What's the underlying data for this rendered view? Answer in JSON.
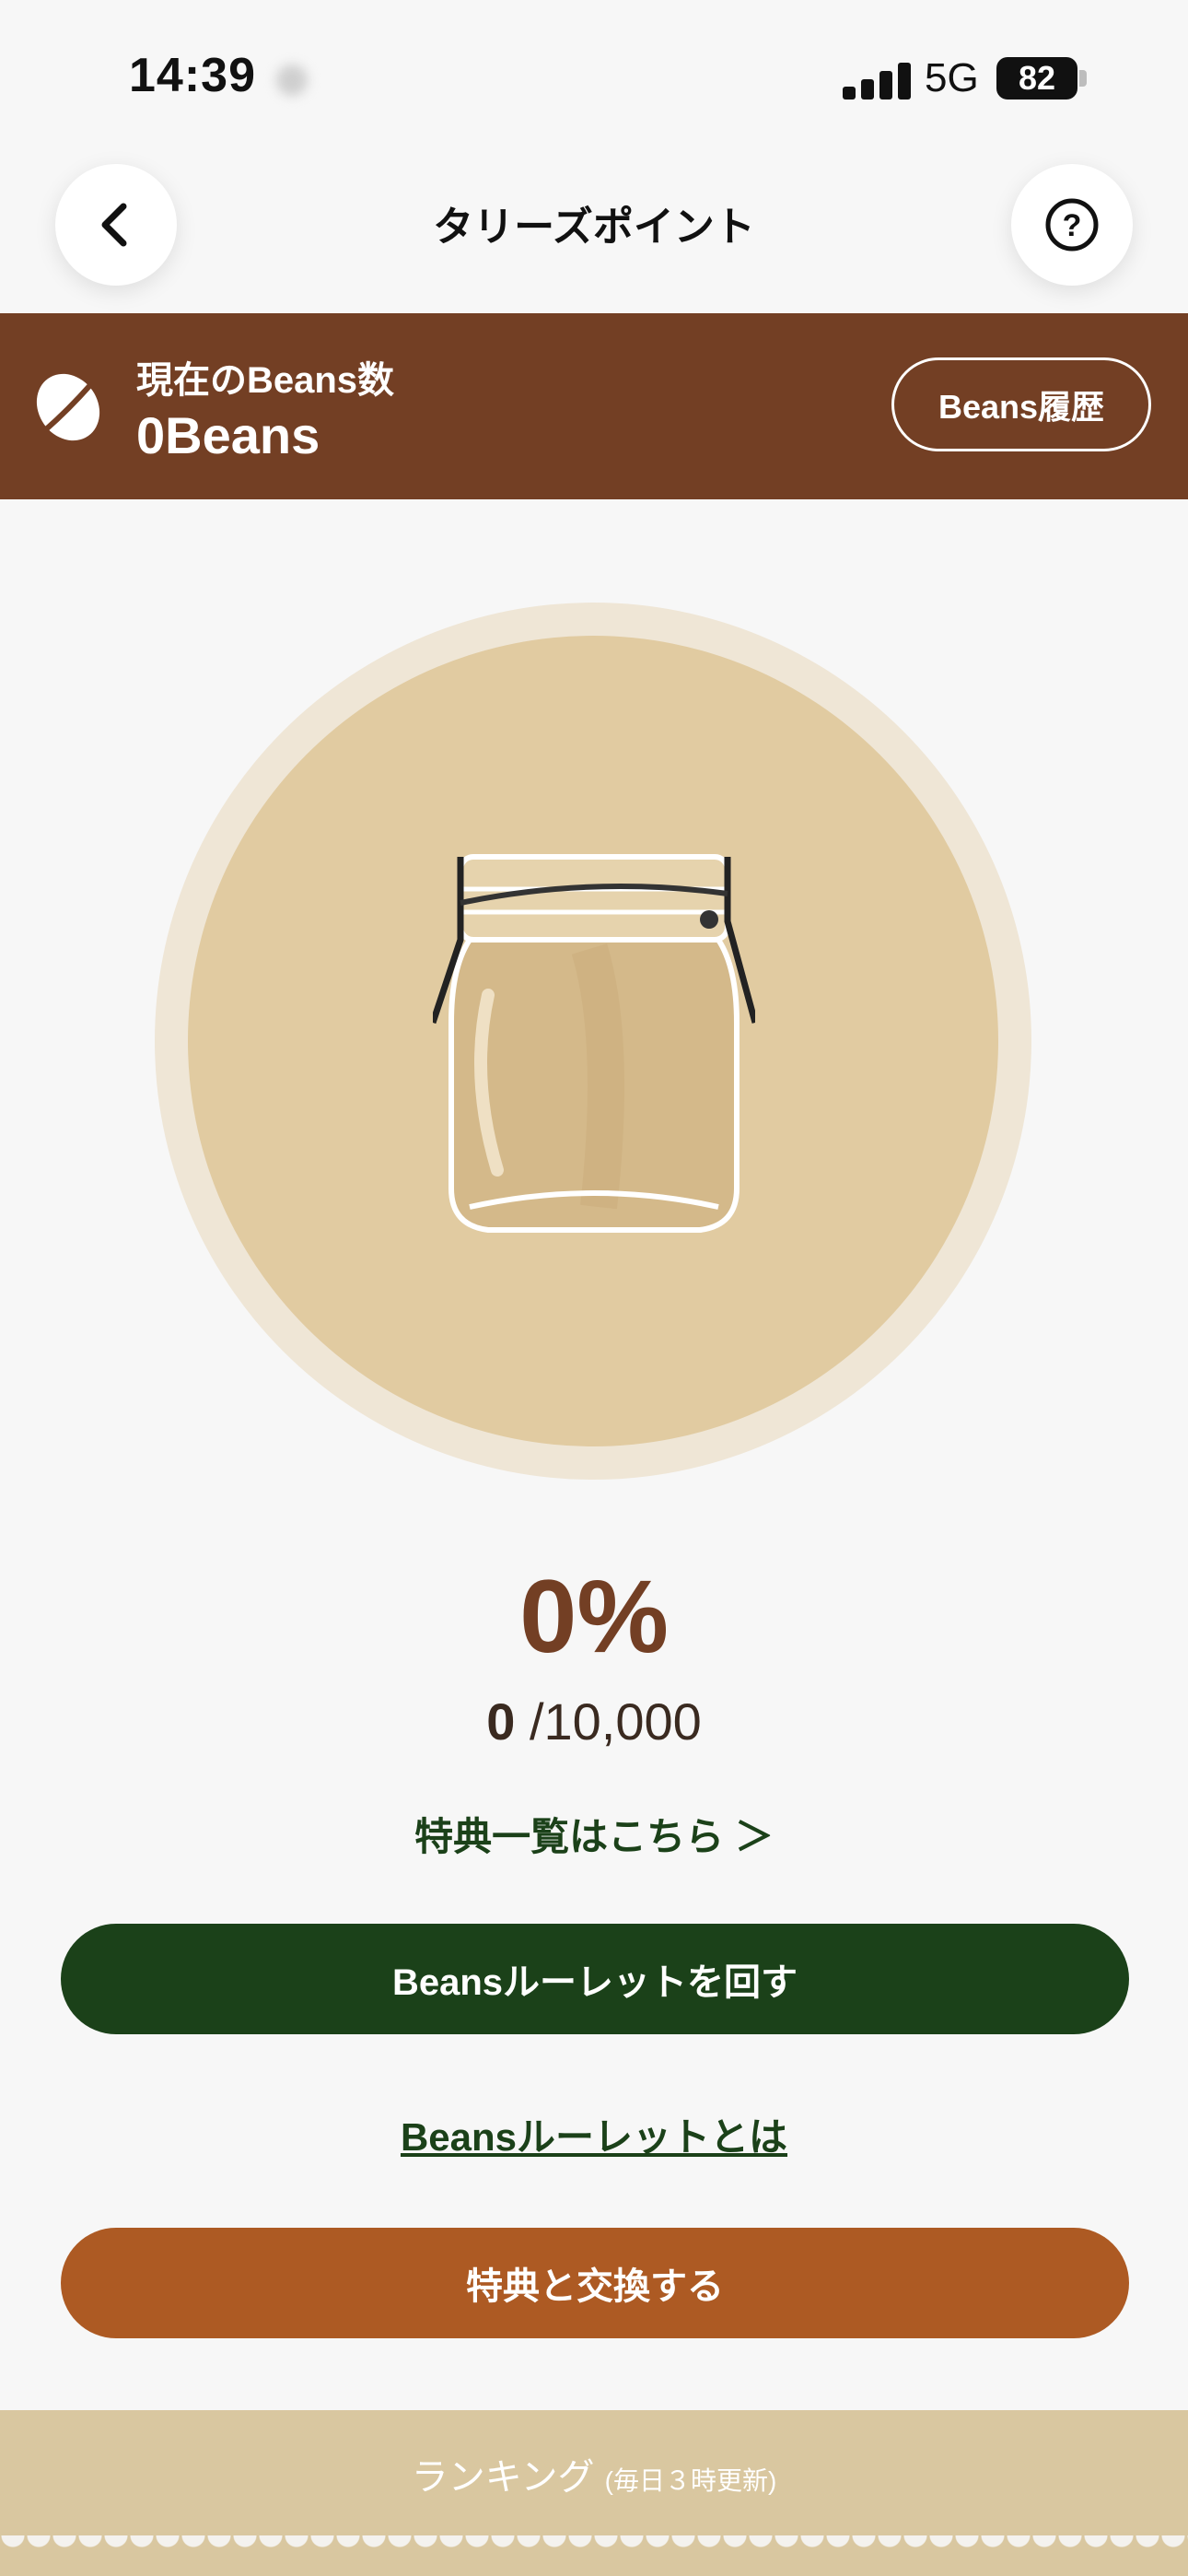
{
  "status_bar": {
    "time": "14:39",
    "network": "5G",
    "battery": "82"
  },
  "header": {
    "title": "タリーズポイント",
    "back_icon": "chevron-left-icon",
    "help_icon": "question-circle-icon"
  },
  "beans": {
    "label": "現在のBeans数",
    "count": "0Beans",
    "history_button": "Beans履歴",
    "icon": "coffee-bean-icon"
  },
  "jar": {
    "icon": "glass-jar-icon",
    "percent": "0%",
    "current": "0",
    "goal": "/10,000"
  },
  "links": {
    "benefits": "特典一覧はこちら ＞",
    "roulette_about": "Beansルーレットとは"
  },
  "buttons": {
    "roulette": "Beansルーレットを回す",
    "exchange": "特典と交換する"
  },
  "ranking": {
    "title": "ランキング",
    "subtitle": "(毎日３時更新)"
  },
  "colors": {
    "brown": "#733f24",
    "green": "#1b4119",
    "orange": "#ad5a23",
    "jar_bg": "#e1cba1"
  }
}
